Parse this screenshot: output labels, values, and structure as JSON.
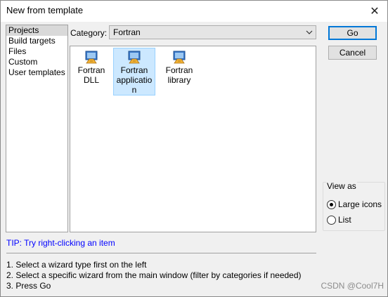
{
  "window": {
    "title": "New from template",
    "close_glyph": "✕"
  },
  "sidebar": {
    "items": [
      {
        "label": "Projects",
        "selected": true
      },
      {
        "label": "Build targets",
        "selected": false
      },
      {
        "label": "Files",
        "selected": false
      },
      {
        "label": "Custom",
        "selected": false
      },
      {
        "label": "User templates",
        "selected": false
      }
    ]
  },
  "category": {
    "label": "Category:",
    "value": "Fortran"
  },
  "wizards": [
    {
      "label": "Fortran\nDLL",
      "icon": "fortran-wizard-icon",
      "selected": false
    },
    {
      "label": "Fortran\napplicatio\nn",
      "icon": "fortran-wizard-icon",
      "selected": true
    },
    {
      "label": "Fortran\nlibrary",
      "icon": "fortran-wizard-icon",
      "selected": false
    }
  ],
  "buttons": {
    "go": "Go",
    "cancel": "Cancel"
  },
  "view_as": {
    "legend": "View as",
    "options": [
      {
        "label": "Large icons",
        "checked": true
      },
      {
        "label": "List",
        "checked": false
      }
    ]
  },
  "tip": "TIP: Try right-clicking an item",
  "instructions": [
    "1. Select a wizard type first on the left",
    "2. Select a specific wizard from the main window (filter by categories if needed)",
    "3. Press Go"
  ],
  "watermark": "CSDN @Cool7H",
  "colors": {
    "tip": "#0000ff",
    "selection": "#cce8ff",
    "default_button_border": "#0078d7"
  }
}
